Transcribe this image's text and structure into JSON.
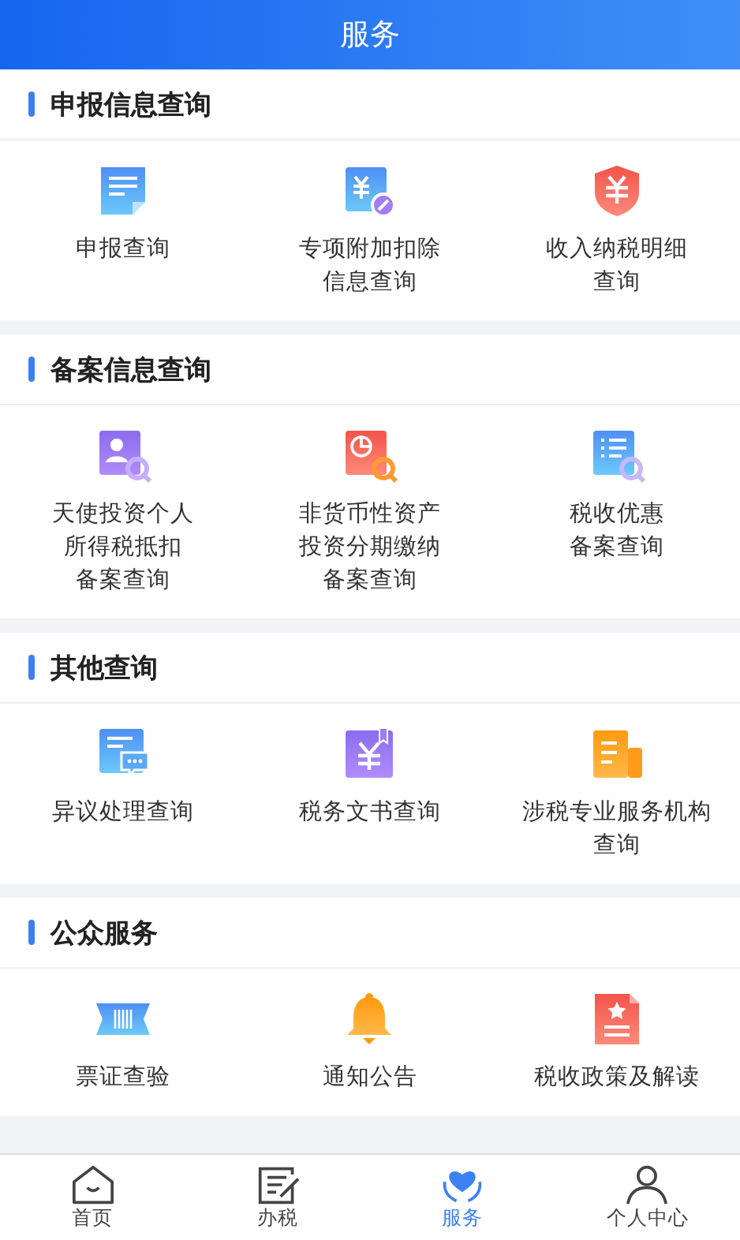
{
  "header": {
    "title": "服务"
  },
  "sections": [
    {
      "title": "申报信息查询",
      "items": [
        {
          "lines": [
            "申报查询"
          ]
        },
        {
          "lines": [
            "专项附加扣除",
            "信息查询"
          ]
        },
        {
          "lines": [
            "收入纳税明细",
            "查询"
          ]
        }
      ]
    },
    {
      "title": "备案信息查询",
      "items": [
        {
          "lines": [
            "天使投资个人",
            "所得税抵扣",
            "备案查询"
          ]
        },
        {
          "lines": [
            "非货币性资产",
            "投资分期缴纳",
            "备案查询"
          ]
        },
        {
          "lines": [
            "税收优惠",
            "备案查询"
          ]
        }
      ]
    },
    {
      "title": "其他查询",
      "items": [
        {
          "lines": [
            "异议处理查询"
          ]
        },
        {
          "lines": [
            "税务文书查询"
          ]
        },
        {
          "lines": [
            "涉税专业服务机构",
            "查询"
          ]
        }
      ]
    },
    {
      "title": "公众服务",
      "items": [
        {
          "lines": [
            "票证查验"
          ]
        },
        {
          "lines": [
            "通知公告"
          ]
        },
        {
          "lines": [
            "税收政策及解读"
          ]
        }
      ]
    }
  ],
  "nav": [
    {
      "label": "首页",
      "selected": false
    },
    {
      "label": "办税",
      "selected": false
    },
    {
      "label": "服务",
      "selected": true
    },
    {
      "label": "个人中心",
      "selected": false
    }
  ]
}
